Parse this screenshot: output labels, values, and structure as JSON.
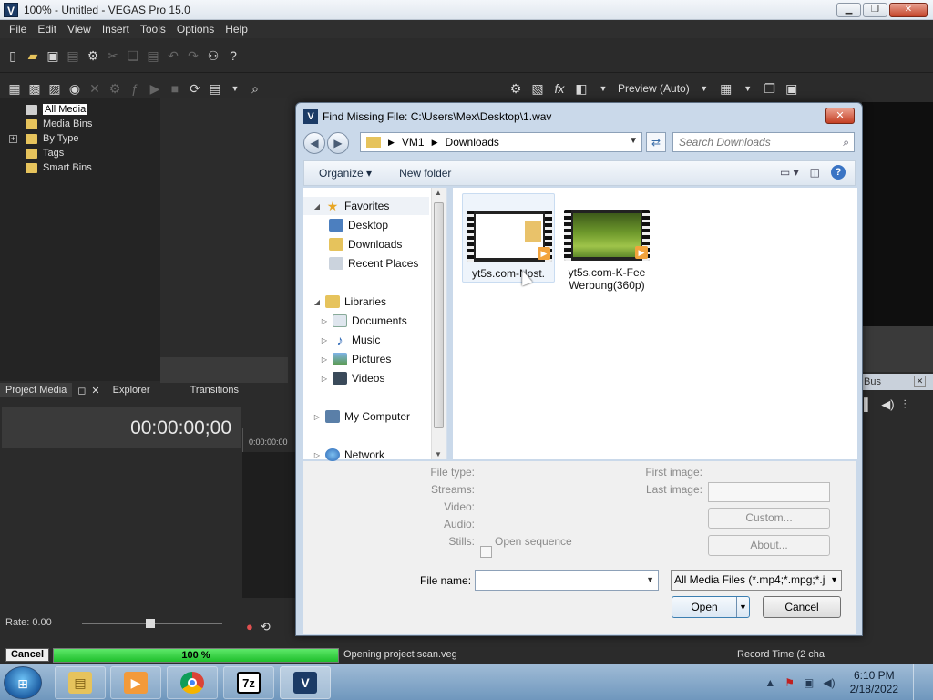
{
  "window": {
    "title": "100% - Untitled - VEGAS Pro 15.0",
    "logo": "V"
  },
  "menu": [
    "File",
    "Edit",
    "View",
    "Insert",
    "Tools",
    "Options",
    "Help"
  ],
  "preview_toolbar": {
    "mode_label": "Preview (Auto)"
  },
  "media_tree": [
    {
      "label": "All Media",
      "selected": true
    },
    {
      "label": "Media Bins"
    },
    {
      "label": "By Type",
      "expandable": true
    },
    {
      "label": "Tags"
    },
    {
      "label": "Smart Bins"
    }
  ],
  "panel_tabs": [
    "Project Media",
    "Explorer",
    "Transitions"
  ],
  "timecode": "00:00:00;00",
  "ruler_time": "0:00:00:00",
  "rate": "Rate: 0.00",
  "bus_panel": {
    "title": "Bus"
  },
  "status": {
    "cancel_label": "Cancel",
    "progress_text": "100 %",
    "progress_percent": 100,
    "message": "Opening project scan.veg",
    "record_time": "Record Time (2 cha"
  },
  "taskbar": {
    "time": "6:10 PM",
    "date": "2/18/2022",
    "apps": [
      "explorer",
      "media-player",
      "chrome",
      "7zip",
      "vegas"
    ]
  },
  "dialog": {
    "title": "Find Missing File: C:\\Users\\Mex\\Desktop\\1.wav",
    "logo": "V",
    "breadcrumb": [
      "VM1",
      "Downloads"
    ],
    "search_placeholder": "Search Downloads",
    "organize_label": "Organize",
    "new_folder_label": "New folder",
    "nav": {
      "favorites": {
        "label": "Favorites",
        "items": [
          "Desktop",
          "Downloads",
          "Recent Places"
        ]
      },
      "libraries": {
        "label": "Libraries",
        "items": [
          "Documents",
          "Music",
          "Pictures",
          "Videos"
        ]
      },
      "computer": "My Computer",
      "network": "Network"
    },
    "files": [
      {
        "name": "yt5s.com-Nost.",
        "selected": true
      },
      {
        "name": "yt5s.com-K-Fee Werbung(360p)",
        "selected": false
      }
    ],
    "details": {
      "file_type": "File type:",
      "streams": "Streams:",
      "video": "Video:",
      "audio": "Audio:",
      "stills": "Stills:",
      "open_sequence": "Open sequence",
      "first_image": "First image:",
      "last_image": "Last image:",
      "custom_label": "Custom...",
      "about_label": "About..."
    },
    "file_name_label": "File name:",
    "file_name_value": "",
    "file_type_filter": "All Media Files (*.mp4;*.mpg;*.j",
    "open_label": "Open",
    "cancel_label": "Cancel"
  }
}
